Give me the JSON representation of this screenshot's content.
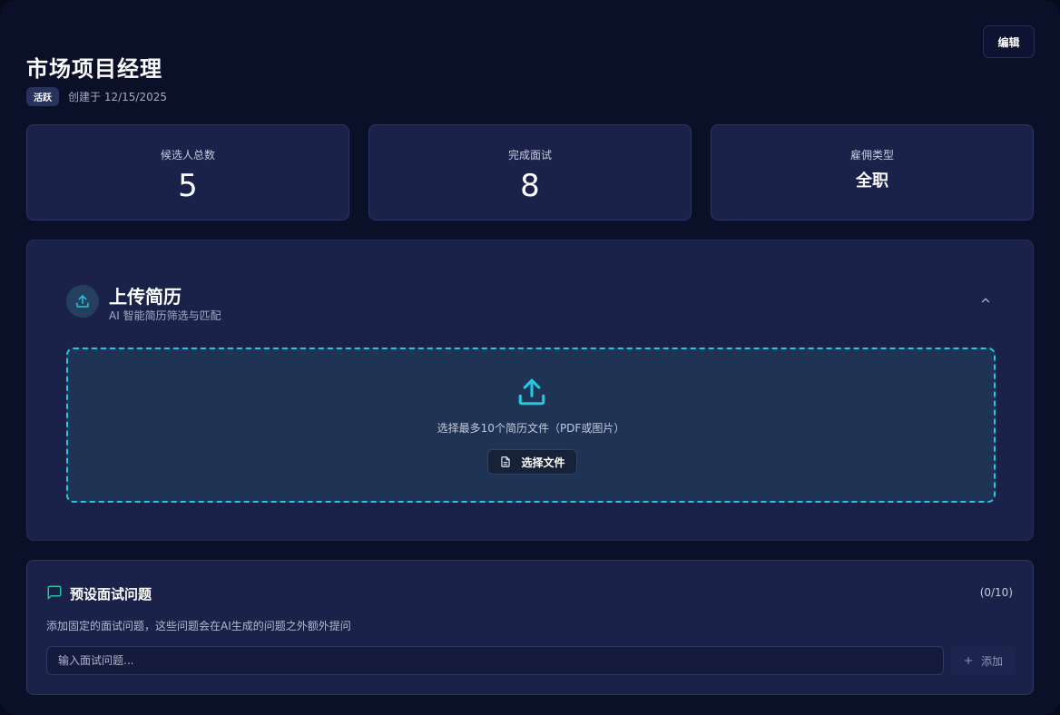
{
  "header": {
    "title": "市场项目经理",
    "status_badge": "活跃",
    "created": "创建于 12/15/2025",
    "edit_label": "编辑"
  },
  "stats": [
    {
      "label": "候选人总数",
      "value": "5"
    },
    {
      "label": "完成面试",
      "value": "8"
    },
    {
      "label": "雇佣类型",
      "value": "全职"
    }
  ],
  "upload": {
    "title": "上传简历",
    "subtitle": "AI 智能简历筛选与匹配",
    "dropzone_text": "选择最多10个简历文件（PDF或图片）",
    "choose_label": "选择文件"
  },
  "questions": {
    "title": "预设面试问题",
    "count": "(0/10)",
    "description": "添加固定的面试问题，这些问题会在AI生成的问题之外额外提问",
    "input_placeholder": "输入面试问题...",
    "add_label": "添加"
  },
  "colors": {
    "accent_cyan": "#22c8e4",
    "accent_green": "#2bc39b",
    "card_bg": "#1b2249",
    "page_bg": "#0b1029"
  },
  "icons": {
    "upload": "upload-icon",
    "collapse": "chevron-up-icon",
    "file": "file-icon",
    "chat": "message-square-icon",
    "plus": "plus-icon"
  }
}
